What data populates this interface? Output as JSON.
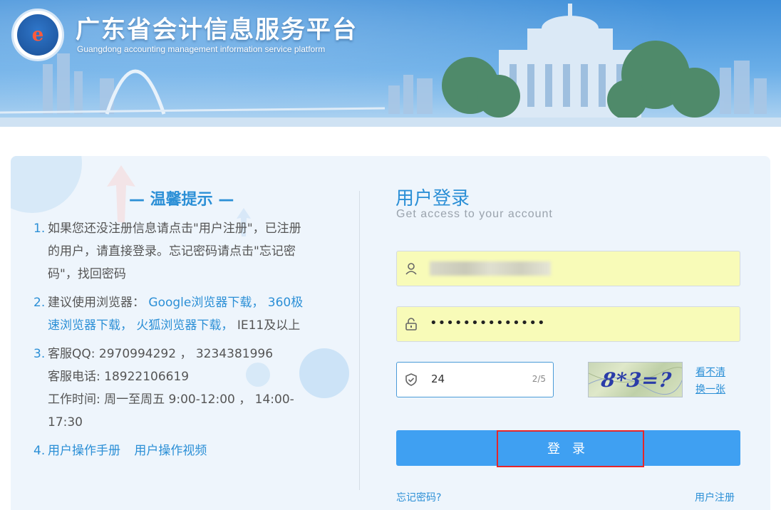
{
  "header": {
    "title": "广东省会计信息服务平台",
    "subtitle": "Guangdong accounting management information service platform",
    "logo_letter": "e"
  },
  "tips": {
    "title": "— 温馨提示 —",
    "items": [
      {
        "num": "1.",
        "lines": [
          "如果您还没注册信息请点击\"用户注册\"，已注册",
          "的用户，请直接登录。忘记密码请点击\"忘记密",
          "码\"，找回密码"
        ]
      },
      {
        "num": "2.",
        "prefix": "建议使用浏览器：",
        "link_google": "Google浏览器下载，",
        "link_360_a": "360极",
        "link_360_b": "速浏览器下载，",
        "link_firefox": "火狐浏览器下载，",
        "suffix": "IE11及以上"
      },
      {
        "num": "3.",
        "lines": [
          "客服QQ: 2970994292 ， 3234381996",
          "客服电话: 18922106619",
          "工作时间: 周一至周五 9:00-12:00 ，  14:00-",
          "17:30"
        ]
      },
      {
        "num": "4.",
        "link_manual": "用户操作手册",
        "link_video": "用户操作视频"
      }
    ]
  },
  "login": {
    "title": "用户登录",
    "subtitle": "Get access to your account",
    "password_masked": "••••••••••••••",
    "captcha_value": "24",
    "captcha_counter": "2/5",
    "captcha_image_text": "8*3=?",
    "refresh_line1": "看不清",
    "refresh_line2": "换一张",
    "login_button": "登 录",
    "forgot_link": "忘记密码?",
    "register_link": "用户注册"
  },
  "colors": {
    "accent": "#2b8fd6",
    "button": "#3fa0f2",
    "input_fill": "#f8fbb8",
    "highlight": "#e5262a"
  }
}
